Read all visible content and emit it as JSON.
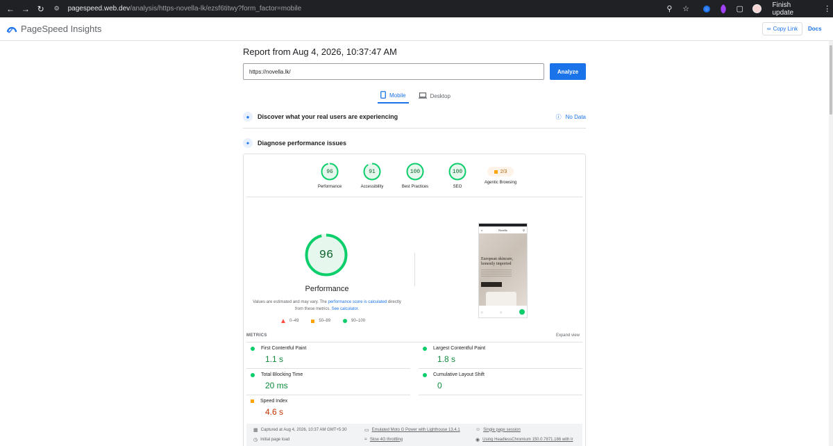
{
  "browser": {
    "url_host": "pagespeed.web.dev",
    "url_path": "/analysis/https-novella-lk/ezsf6titwy?form_factor=mobile",
    "finish_update_label": "Finish update"
  },
  "app": {
    "title": "PageSpeed Insights",
    "copy_link_label": "Copy Link",
    "docs_label": "Docs"
  },
  "report": {
    "title": "Report from Aug 4, 2026, 10:37:47 AM",
    "url_value": "https://novella.lk/",
    "analyze_label": "Analyze"
  },
  "tabs": [
    {
      "label": "Mobile",
      "active": true
    },
    {
      "label": "Desktop",
      "active": false
    }
  ],
  "field_data": {
    "heading": "Discover what your real users are experiencing",
    "no_data_label": "No Data"
  },
  "diagnose": {
    "heading": "Diagnose performance issues"
  },
  "categories": [
    {
      "label": "Performance",
      "score": "96",
      "fraction": 0.96
    },
    {
      "label": "Accessibility",
      "score": "91",
      "fraction": 0.91
    },
    {
      "label": "Best Practices",
      "score": "100",
      "fraction": 1.0
    },
    {
      "label": "SEO",
      "score": "100",
      "fraction": 1.0
    },
    {
      "label": "Agentic Browsing",
      "score": "2/3"
    }
  ],
  "performance": {
    "score": "96",
    "fraction": 0.96,
    "label": "Performance",
    "note_prefix": "Values are estimated and may vary. The ",
    "note_link1": "performance score is calculated",
    "note_middle": " directly from these metrics. ",
    "note_link2": "See calculator.",
    "legend": [
      "0–49",
      "50–89",
      "90–100"
    ]
  },
  "phone_preview": {
    "brand": "Novella",
    "hero_title_line1": "European skincare,",
    "hero_title_line2": "honestly imported"
  },
  "metrics": {
    "heading": "METRICS",
    "expand_label": "Expand view",
    "items": [
      {
        "name": "First Contentful Paint",
        "value": "1.1 s",
        "status": "green"
      },
      {
        "name": "Largest Contentful Paint",
        "value": "1.8 s",
        "status": "green"
      },
      {
        "name": "Total Blocking Time",
        "value": "20 ms",
        "status": "green"
      },
      {
        "name": "Cumulative Layout Shift",
        "value": "0",
        "status": "green"
      },
      {
        "name": "Speed Index",
        "value": "4.6 s",
        "status": "orange"
      }
    ]
  },
  "run_info": {
    "captured": "Captured at Aug 4, 2026, 10:37 AM GMT+5:30",
    "initial_load": "Initial page load",
    "device": "Emulated Moto G Power with Lighthouse 13.4.1",
    "throttling": "Slow 4G throttling",
    "session": "Single page session",
    "browser": "Using HeadlessChromium 150.0.7871.186 with lr"
  },
  "colors": {
    "accent": "#1a73e8",
    "pass": "#0cce6b",
    "average": "#ffa400",
    "fail": "#ff4e42"
  }
}
